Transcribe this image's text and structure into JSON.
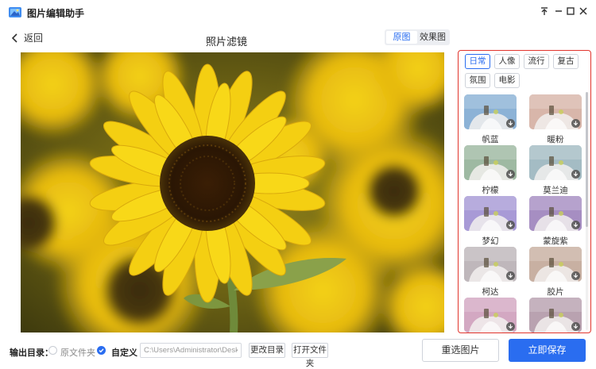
{
  "app": {
    "title": "图片编辑助手"
  },
  "header": {
    "back_label": "返回",
    "title": "照片滤镜"
  },
  "view_toggle": {
    "original": "原图",
    "effect": "效果图",
    "active": "original"
  },
  "filter_panel": {
    "categories": [
      {
        "label": "日常",
        "active": true
      },
      {
        "label": "人像",
        "active": false
      },
      {
        "label": "流行",
        "active": false
      },
      {
        "label": "复古",
        "active": false
      },
      {
        "label": "氛围",
        "active": false
      },
      {
        "label": "电影",
        "active": false
      }
    ],
    "filters": [
      {
        "label": "帆蓝",
        "tint": "#8cb2d6"
      },
      {
        "label": "暖粉",
        "tint": "#d8b6aa"
      },
      {
        "label": "柠檬",
        "tint": "#9eb9a2"
      },
      {
        "label": "莫兰迪",
        "tint": "#a4bcc4"
      },
      {
        "label": "梦幻",
        "tint": "#a89ad6"
      },
      {
        "label": "蒙旋紫",
        "tint": "#a68ec2"
      },
      {
        "label": "柯达",
        "tint": "#bfb7bb"
      },
      {
        "label": "胶片",
        "tint": "#c8b0a2"
      },
      {
        "label": "",
        "tint": "#d3a8c2"
      },
      {
        "label": "",
        "tint": "#b9a2b0"
      }
    ],
    "border_color": "#e2352d"
  },
  "bottom": {
    "output_label": "输出目录：",
    "option_original": "原文件夹",
    "option_custom": "自定义",
    "selected_option": "custom",
    "path_value": "C:\\Users\\Administrator\\Desktop\\$",
    "change_dir_label": "更改目录",
    "open_folder_label": "打开文件夹",
    "reselect_label": "重选图片",
    "save_label": "立即保存"
  },
  "colors": {
    "accent": "#2a6df0",
    "highlight_border": "#e2352d"
  },
  "icons": {
    "app_logo": "image-editor-logo-icon",
    "back": "chevron-left-icon",
    "pin": "pin-icon",
    "minimize": "minimize-icon",
    "maximize": "maximize-icon",
    "close": "close-icon",
    "download": "download-arrow-icon",
    "radio_checked": "check-circle-icon"
  }
}
